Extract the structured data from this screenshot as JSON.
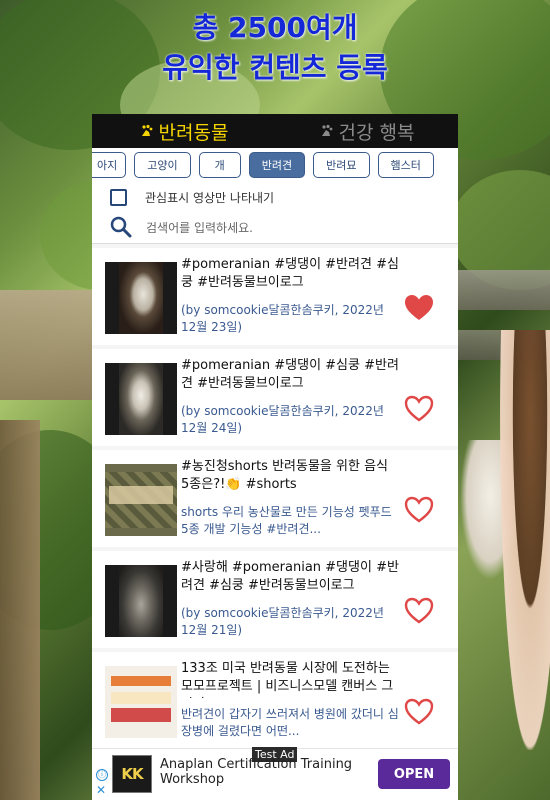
{
  "headline": {
    "line1": "총 2500여개",
    "line2": "유익한 컨텐츠 등록"
  },
  "top_tabs": [
    {
      "label": "반려동물",
      "active": true
    },
    {
      "label": "건강 행복",
      "active": false
    }
  ],
  "chips": [
    "아지",
    "고양이",
    "개",
    "반려견",
    "반려묘",
    "햄스터"
  ],
  "selected_chip": "반려견",
  "filter": {
    "label": "관심표시 영상만 나타내기"
  },
  "search": {
    "placeholder": "검색어를 입력하세요."
  },
  "items": [
    {
      "title": "#pomeranian #댕댕이 #반려견 #심쿵 #반려동물브이로그",
      "subtitle": "(by somcookie달콤한솜쿠키, 2022년 12월 23일)",
      "liked": true
    },
    {
      "title": "#pomeranian #댕댕이 #심쿵 #반려견 #반려동물브이로그",
      "subtitle": "(by somcookie달콤한솜쿠키, 2022년 12월 24일)",
      "liked": false
    },
    {
      "title": "#농진청shorts 반려동물을 위한 음식 5종은?!👏 #shorts",
      "subtitle": "shorts 우리 농산물로 만든 기능성 펫푸드 5종 개발 기능성 #반려견...",
      "liked": false
    },
    {
      "title": "#사랑해 #pomeranian #댕댕이 #반려견 #심쿵 #반려동물브이로그",
      "subtitle": "(by somcookie달콤한솜쿠키, 2022년 12월 21일)",
      "liked": false
    },
    {
      "title": "133조 미국 반려동물 시장에 도전하는 모모프로젝트 | 비즈니스모델 캔버스 그리기",
      "subtitle": "반려견이 갑자기 쓰러져서 병원에 갔더니 심장병에 걸렸다면 어떤...",
      "liked": false
    }
  ],
  "ad": {
    "tag": "Test Ad",
    "logo_text": "KK",
    "text": "Anaplan Certification Training Workshop",
    "button": "OPEN",
    "info_icon": "ⓘ",
    "close_icon": "✕"
  },
  "colors": {
    "headline": "#1428d8",
    "active_tab": "#f5d400",
    "chip_selected_bg": "#4a6da0",
    "heart_filled": "#e04848",
    "heart_outline": "#e04848",
    "ad_button": "#5b2a9a"
  },
  "icons": {
    "tab_active": "paw-icon",
    "tab_inactive": "paw-icon",
    "search": "search-icon",
    "like_filled": "heart-filled-icon",
    "like_outline": "heart-outline-icon"
  }
}
